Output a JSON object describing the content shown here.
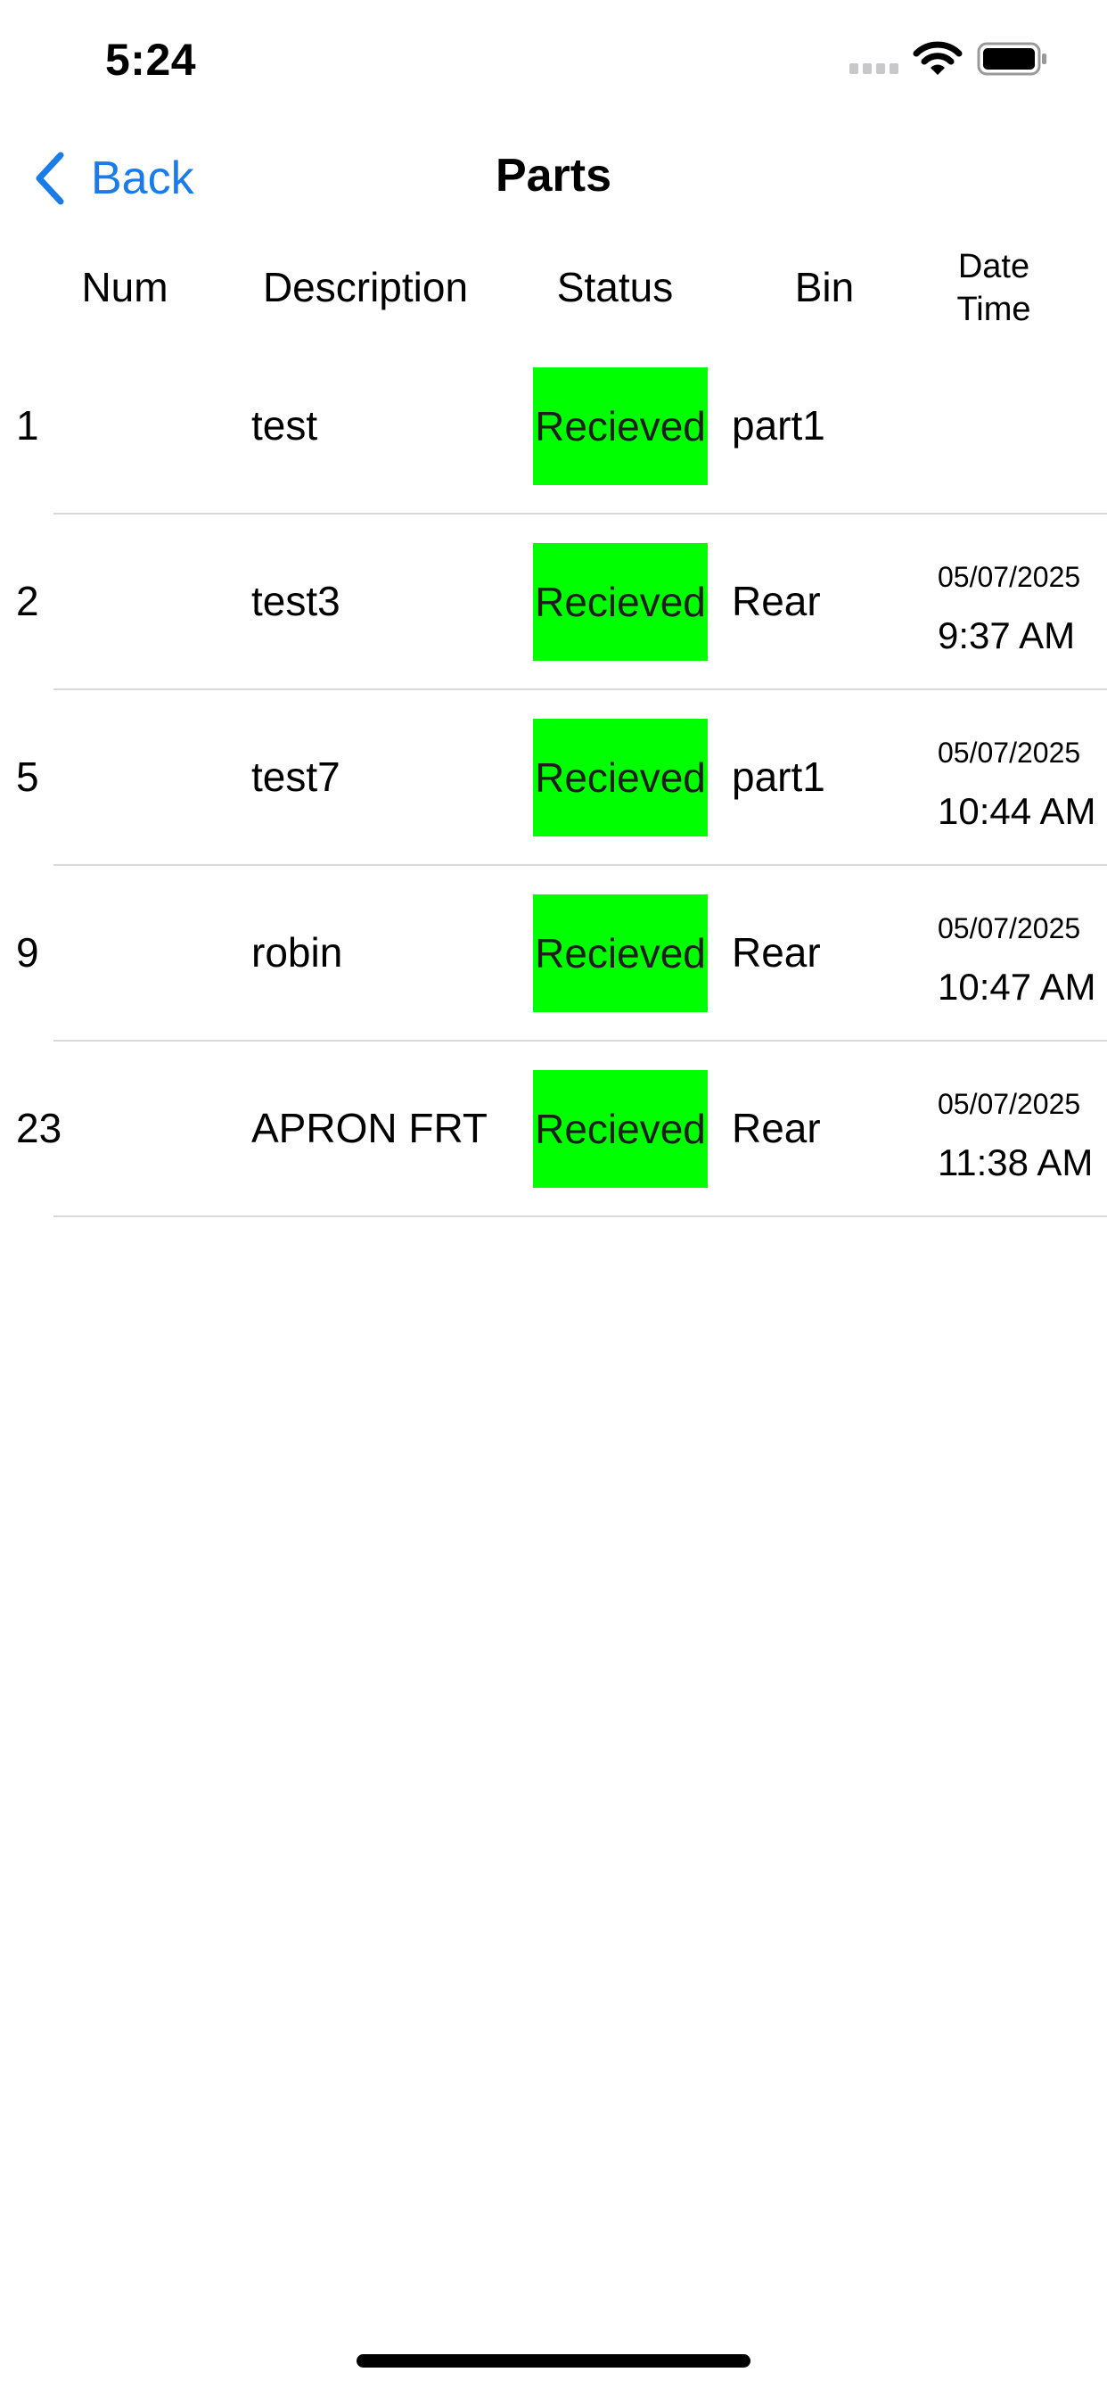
{
  "status_bar": {
    "time": "5:24"
  },
  "nav": {
    "back_label": "Back",
    "title": "Parts"
  },
  "columns": {
    "num": "Num",
    "description": "Description",
    "status": "Status",
    "bin": "Bin",
    "date_time_line1": "Date",
    "date_time_line2": "Time"
  },
  "rows": [
    {
      "num": "1",
      "description": "test",
      "status": "Recieved",
      "bin": "part1",
      "date": "",
      "time": ""
    },
    {
      "num": "2",
      "description": "test3",
      "status": "Recieved",
      "bin": "Rear",
      "date": "05/07/2025",
      "time": "9:37 AM"
    },
    {
      "num": "5",
      "description": "test7",
      "status": "Recieved",
      "bin": "part1",
      "date": "05/07/2025",
      "time": "10:44 AM"
    },
    {
      "num": "9",
      "description": "robin",
      "status": "Recieved",
      "bin": "Rear",
      "date": "05/07/2025",
      "time": "10:47 AM"
    },
    {
      "num": "23",
      "description": "APRON FRT",
      "status": "Recieved",
      "bin": "Rear",
      "date": "05/07/2025",
      "time": "11:38 AM"
    }
  ],
  "colors": {
    "accent": "#1a7bea",
    "status_received": "#00ff00",
    "divider": "#d9d9d9"
  },
  "icons": {
    "back": "chevron-left-icon",
    "signal": "cellular-signal-icon",
    "wifi": "wifi-icon",
    "battery": "battery-icon"
  }
}
